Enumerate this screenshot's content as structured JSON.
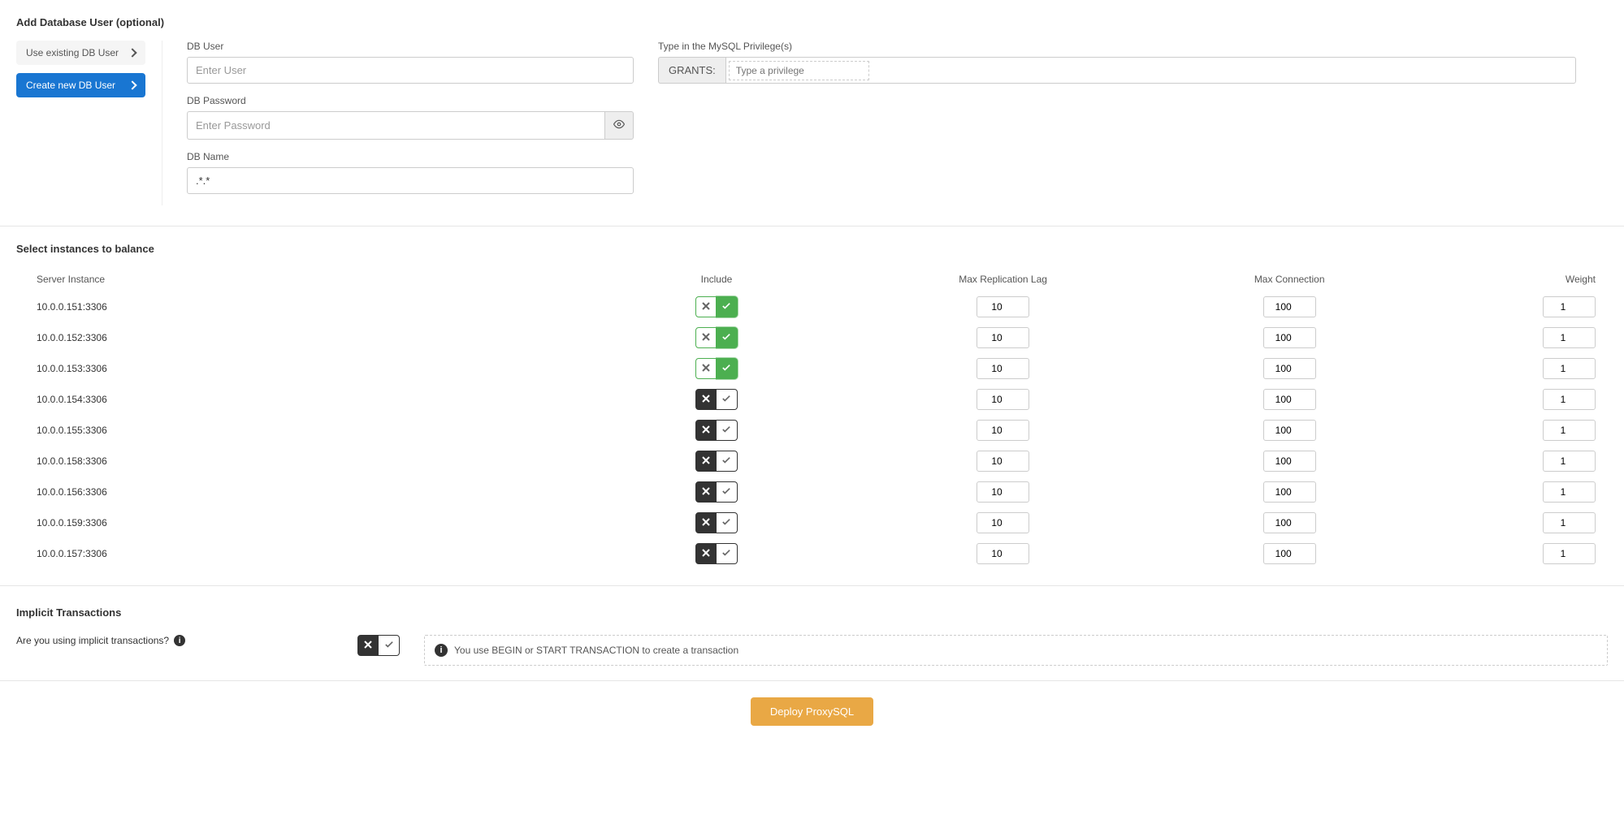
{
  "add_user": {
    "title": "Add Database User (optional)",
    "existing_btn": "Use existing DB User",
    "create_btn": "Create new DB User"
  },
  "form": {
    "db_user_label": "DB User",
    "db_user_placeholder": "Enter User",
    "db_password_label": "DB Password",
    "db_password_placeholder": "Enter Password",
    "db_name_label": "DB Name",
    "db_name_value": ".*.*"
  },
  "privileges": {
    "label": "Type in the MySQL Privilege(s)",
    "grants_label": "GRANTS:",
    "placeholder": "Type a privilege"
  },
  "instances": {
    "title": "Select instances to balance",
    "headers": {
      "server": "Server Instance",
      "include": "Include",
      "lag": "Max Replication Lag",
      "conn": "Max Connection",
      "weight": "Weight"
    },
    "rows": [
      {
        "server": "10.0.0.151:3306",
        "included": true,
        "lag": "10",
        "conn": "100",
        "weight": "1"
      },
      {
        "server": "10.0.0.152:3306",
        "included": true,
        "lag": "10",
        "conn": "100",
        "weight": "1"
      },
      {
        "server": "10.0.0.153:3306",
        "included": true,
        "lag": "10",
        "conn": "100",
        "weight": "1"
      },
      {
        "server": "10.0.0.154:3306",
        "included": false,
        "lag": "10",
        "conn": "100",
        "weight": "1"
      },
      {
        "server": "10.0.0.155:3306",
        "included": false,
        "lag": "10",
        "conn": "100",
        "weight": "1"
      },
      {
        "server": "10.0.0.158:3306",
        "included": false,
        "lag": "10",
        "conn": "100",
        "weight": "1"
      },
      {
        "server": "10.0.0.156:3306",
        "included": false,
        "lag": "10",
        "conn": "100",
        "weight": "1"
      },
      {
        "server": "10.0.0.159:3306",
        "included": false,
        "lag": "10",
        "conn": "100",
        "weight": "1"
      },
      {
        "server": "10.0.0.157:3306",
        "included": false,
        "lag": "10",
        "conn": "100",
        "weight": "1"
      }
    ]
  },
  "implicit": {
    "title": "Implicit Transactions",
    "question": "Are you using implicit transactions?",
    "message": "You use BEGIN or START TRANSACTION to create a transaction",
    "value": false
  },
  "deploy": {
    "label": "Deploy ProxySQL"
  }
}
